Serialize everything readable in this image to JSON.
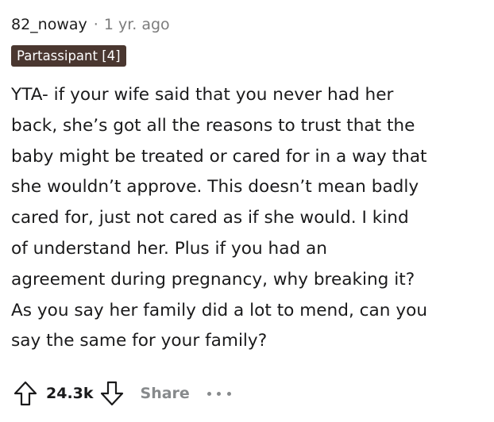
{
  "comment": {
    "username": "82_noway",
    "separator": "·",
    "timestamp": "1 yr. ago",
    "flair": "Partassipant [4]",
    "body_lines": [
      "YTA- if your wife said that you never had her",
      "back, she’s got all the reasons to trust that the",
      "baby might be treated or cared for in a way that",
      "she wouldn’t approve. This doesn’t mean badly",
      "cared for, just not cared as if she would. I kind",
      "of understand her. Plus if you had an",
      "agreement during pregnancy, why breaking it?",
      "As you say her family did a lot to mend, can you",
      "say the same for your family?"
    ],
    "score": "24.3k",
    "share_label": "Share",
    "icons": {
      "upvote": "upvote-arrow-icon",
      "downvote": "downvote-arrow-icon",
      "more": "more-options-icon"
    }
  },
  "colors": {
    "text": "#1a1a1b",
    "meta": "#7c7c7c",
    "flair_bg": "#4a3730",
    "flair_text": "#ffffff",
    "action_gray": "#878a8c"
  }
}
